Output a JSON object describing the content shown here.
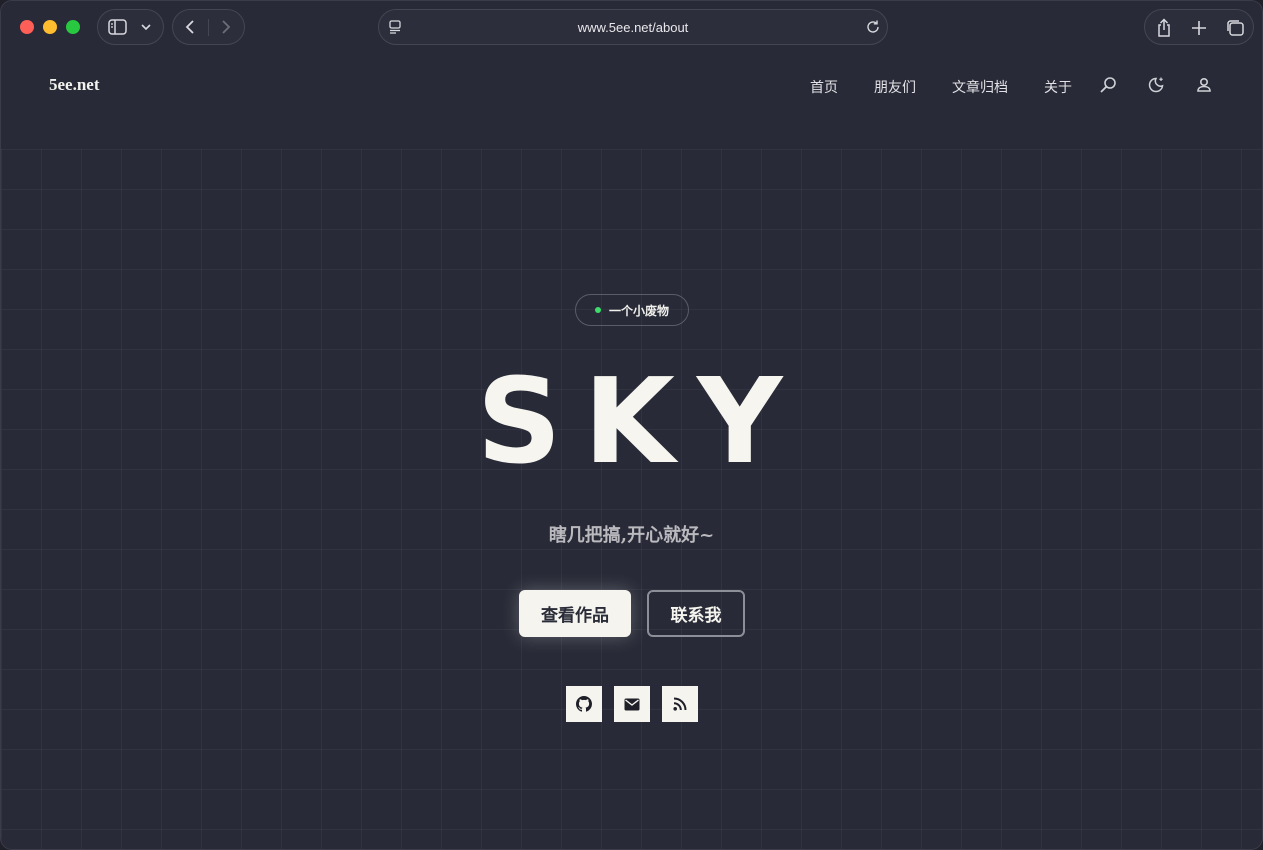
{
  "browser": {
    "url": "www.5ee.net/about"
  },
  "site": {
    "logo": "5ee.net",
    "nav": [
      "首页",
      "朋友们",
      "文章归档",
      "关于"
    ]
  },
  "hero": {
    "badge": "一个小废物",
    "title": "SKY",
    "subtitle": "瞎几把搞,开心就好~",
    "primary_button": "查看作品",
    "secondary_button": "联系我",
    "social_icons": [
      "github-icon",
      "mail-icon",
      "rss-icon"
    ]
  },
  "colors": {
    "background": "#282a37",
    "accent_dot": "#3ddc6b",
    "foreground": "#f5f4ee"
  }
}
